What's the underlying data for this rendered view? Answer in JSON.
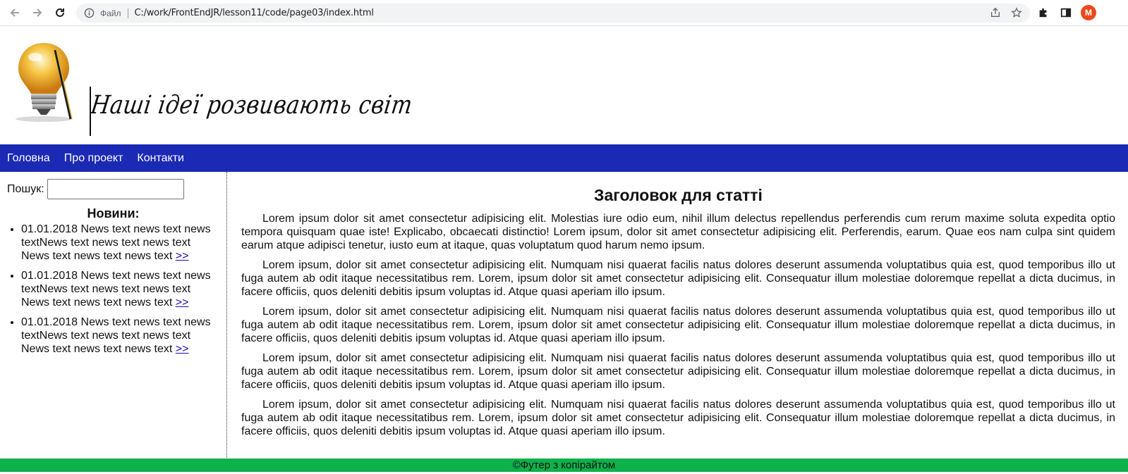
{
  "browser": {
    "file_label": "Файл",
    "url": "C:/work/FrontEndJR/lesson11/code/page03/index.html",
    "profile_initial": "M"
  },
  "header": {
    "slogan": "Наші ідеї розвивають світ"
  },
  "menu": {
    "items": [
      {
        "label": "Головна"
      },
      {
        "label": "Про проект"
      },
      {
        "label": "Контакти"
      }
    ]
  },
  "sidebar": {
    "search_label": "Пошук:",
    "search_value": "",
    "news_title": "Новини:",
    "news": [
      {
        "text": "01.01.2018 News text news text news textNews text news text news text News text news text news text ",
        "link": ">>"
      },
      {
        "text": "01.01.2018 News text news text news textNews text news text news text News text news text news text ",
        "link": ">>"
      },
      {
        "text": "01.01.2018 News text news text news textNews text news text news text News text news text news text ",
        "link": ">>"
      }
    ]
  },
  "article": {
    "title": "Заголовок для статті",
    "paragraphs": [
      "Lorem ipsum dolor sit amet consectetur adipisicing elit. Molestias iure odio eum, nihil illum delectus repellendus perferendis cum rerum maxime soluta expedita optio tempora quisquam quae iste! Explicabo, obcaecati distinctio! Lorem ipsum, dolor sit amet consectetur adipisicing elit. Perferendis, earum. Quae eos nam culpa sint quidem earum atque adipisci tenetur, iusto eum at itaque, quas voluptatum quod harum nemo ipsum.",
      "Lorem ipsum, dolor sit amet consectetur adipisicing elit. Numquam nisi quaerat facilis natus dolores deserunt assumenda voluptatibus quia est, quod temporibus illo ut fuga autem ab odit itaque necessitatibus rem. Lorem, ipsum dolor sit amet consectetur adipisicing elit. Consequatur illum molestiae doloremque repellat a dicta ducimus, in facere officiis, quos deleniti debitis ipsum voluptas id. Atque quasi aperiam illo ipsum.",
      "Lorem ipsum, dolor sit amet consectetur adipisicing elit. Numquam nisi quaerat facilis natus dolores deserunt assumenda voluptatibus quia est, quod temporibus illo ut fuga autem ab odit itaque necessitatibus rem. Lorem, ipsum dolor sit amet consectetur adipisicing elit. Consequatur illum molestiae doloremque repellat a dicta ducimus, in facere officiis, quos deleniti debitis ipsum voluptas id. Atque quasi aperiam illo ipsum.",
      "Lorem ipsum, dolor sit amet consectetur adipisicing elit. Numquam nisi quaerat facilis natus dolores deserunt assumenda voluptatibus quia est, quod temporibus illo ut fuga autem ab odit itaque necessitatibus rem. Lorem, ipsum dolor sit amet consectetur adipisicing elit. Consequatur illum molestiae doloremque repellat a dicta ducimus, in facere officiis, quos deleniti debitis ipsum voluptas id. Atque quasi aperiam illo ipsum.",
      "Lorem ipsum, dolor sit amet consectetur adipisicing elit. Numquam nisi quaerat facilis natus dolores deserunt assumenda voluptatibus quia est, quod temporibus illo ut fuga autem ab odit itaque necessitatibus rem. Lorem, ipsum dolor sit amet consectetur adipisicing elit. Consequatur illum molestiae doloremque repellat a dicta ducimus, in facere officiis, quos deleniti debitis ipsum voluptas id. Atque quasi aperiam illo ipsum."
    ]
  },
  "footer": {
    "text": "©Футер з копірайтом"
  },
  "colors": {
    "menu_bg": "#1b2ab5",
    "footer_bg": "#0eb14a"
  }
}
